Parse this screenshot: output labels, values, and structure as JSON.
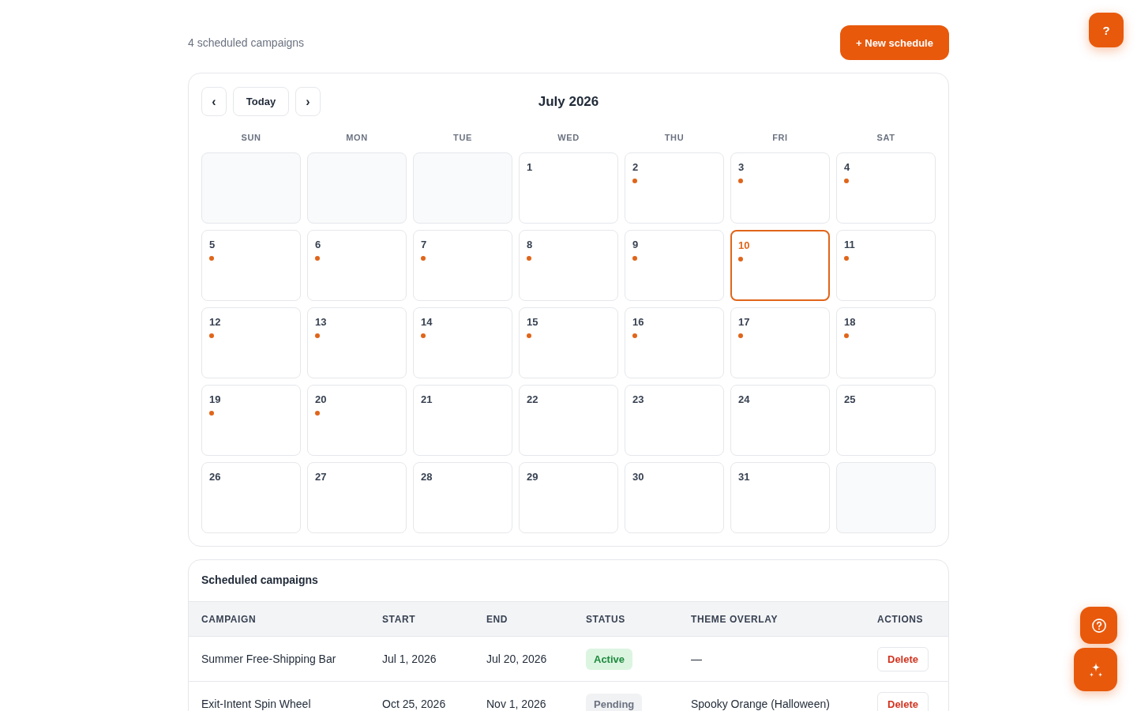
{
  "header": {
    "summary": "4 scheduled campaigns",
    "new_schedule_button": "+ New schedule"
  },
  "help_button": {
    "label": "?"
  },
  "calendar": {
    "nav": {
      "previous": "‹",
      "today": "Today",
      "next": "›"
    },
    "title": "July 2026",
    "weekdays": [
      "SUN",
      "MON",
      "TUE",
      "WED",
      "THU",
      "FRI",
      "SAT"
    ],
    "days": [
      {
        "kind": "blank"
      },
      {
        "kind": "blank"
      },
      {
        "kind": "blank"
      },
      {
        "kind": "day",
        "day": "1",
        "scheduled": false,
        "selected": false
      },
      {
        "kind": "day",
        "day": "2",
        "scheduled": true,
        "selected": false
      },
      {
        "kind": "day",
        "day": "3",
        "scheduled": true,
        "selected": false
      },
      {
        "kind": "day",
        "day": "4",
        "scheduled": true,
        "selected": false
      },
      {
        "kind": "day",
        "day": "5",
        "scheduled": true,
        "selected": false
      },
      {
        "kind": "day",
        "day": "6",
        "scheduled": true,
        "selected": false
      },
      {
        "kind": "day",
        "day": "7",
        "scheduled": true,
        "selected": false
      },
      {
        "kind": "day",
        "day": "8",
        "scheduled": true,
        "selected": false
      },
      {
        "kind": "day",
        "day": "9",
        "scheduled": true,
        "selected": false
      },
      {
        "kind": "day",
        "day": "10",
        "scheduled": true,
        "selected": true
      },
      {
        "kind": "day",
        "day": "11",
        "scheduled": true,
        "selected": false
      },
      {
        "kind": "day",
        "day": "12",
        "scheduled": true,
        "selected": false
      },
      {
        "kind": "day",
        "day": "13",
        "scheduled": true,
        "selected": false
      },
      {
        "kind": "day",
        "day": "14",
        "scheduled": true,
        "selected": false
      },
      {
        "kind": "day",
        "day": "15",
        "scheduled": true,
        "selected": false
      },
      {
        "kind": "day",
        "day": "16",
        "scheduled": true,
        "selected": false
      },
      {
        "kind": "day",
        "day": "17",
        "scheduled": true,
        "selected": false
      },
      {
        "kind": "day",
        "day": "18",
        "scheduled": true,
        "selected": false
      },
      {
        "kind": "day",
        "day": "19",
        "scheduled": true,
        "selected": false
      },
      {
        "kind": "day",
        "day": "20",
        "scheduled": true,
        "selected": false
      },
      {
        "kind": "day",
        "day": "21",
        "scheduled": false,
        "selected": false
      },
      {
        "kind": "day",
        "day": "22",
        "scheduled": false,
        "selected": false
      },
      {
        "kind": "day",
        "day": "23",
        "scheduled": false,
        "selected": false
      },
      {
        "kind": "day",
        "day": "24",
        "scheduled": false,
        "selected": false
      },
      {
        "kind": "day",
        "day": "25",
        "scheduled": false,
        "selected": false
      },
      {
        "kind": "day",
        "day": "26",
        "scheduled": false,
        "selected": false
      },
      {
        "kind": "day",
        "day": "27",
        "scheduled": false,
        "selected": false
      },
      {
        "kind": "day",
        "day": "28",
        "scheduled": false,
        "selected": false
      },
      {
        "kind": "day",
        "day": "29",
        "scheduled": false,
        "selected": false
      },
      {
        "kind": "day",
        "day": "30",
        "scheduled": false,
        "selected": false
      },
      {
        "kind": "day",
        "day": "31",
        "scheduled": false,
        "selected": false
      },
      {
        "kind": "blank"
      }
    ]
  },
  "campaigns": {
    "title": "Scheduled campaigns",
    "columns": [
      "CAMPAIGN",
      "START",
      "END",
      "STATUS",
      "THEME OVERLAY",
      "ACTIONS"
    ],
    "rows": [
      {
        "campaign": "Summer Free-Shipping Bar",
        "start": "Jul 1, 2026",
        "end": "Jul 20, 2026",
        "status": {
          "label": "Active",
          "kind": "active"
        },
        "theme_overlay": "—",
        "action": "Delete"
      },
      {
        "campaign": "Exit-Intent Spin Wheel",
        "start": "Oct 25, 2026",
        "end": "Nov 1, 2026",
        "status": {
          "label": "Pending",
          "kind": "pending"
        },
        "theme_overlay": "Spooky Orange (Halloween)",
        "action": "Delete"
      }
    ]
  }
}
